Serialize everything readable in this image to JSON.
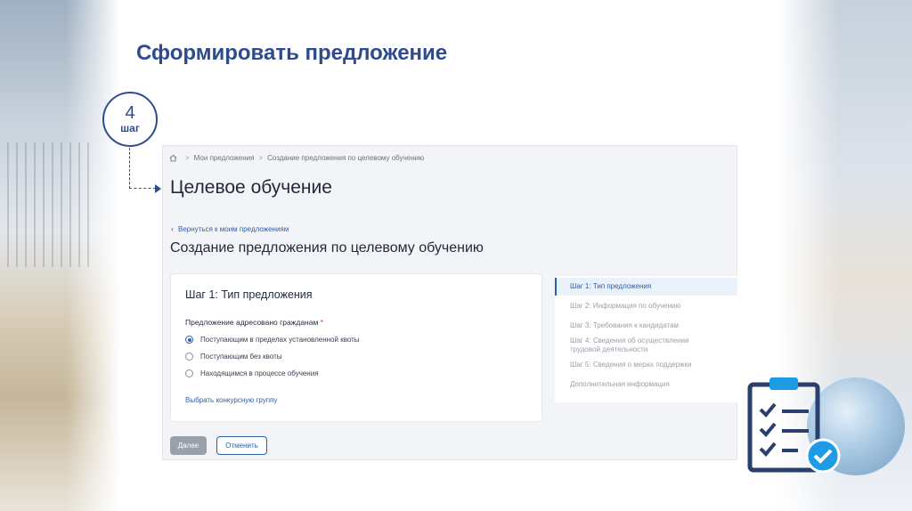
{
  "slide": {
    "title": "Сформировать предложение",
    "step_number": "4",
    "step_word": "шаг"
  },
  "breadcrumb": {
    "items": [
      "Мои предложения",
      "Создание предложения по целевому обучению"
    ],
    "separator": ">"
  },
  "page": {
    "heading": "Целевое обучение",
    "back_link": "Вернуться к моим предложениям",
    "sub_heading": "Создание предложения по целевому обучению"
  },
  "form": {
    "card_title": "Шаг 1: Тип предложения",
    "field_label": "Предложение адресовано гражданам",
    "required_mark": "*",
    "options": [
      {
        "label": "Поступающим в пределах установленной квоты",
        "checked": true
      },
      {
        "label": "Поступающим без квоты",
        "checked": false
      },
      {
        "label": "Находящимся в процессе обучения",
        "checked": false
      }
    ],
    "group_link": "Выбрать конкурсную группу"
  },
  "steps_nav": {
    "items": [
      "Шаг 1: Тип предложения",
      "Шаг 2: Информация по обучению",
      "Шаг 3: Требования к кандидатам",
      "Шаг 4: Сведения об осуществлении трудовой деятельности",
      "Шаг 5: Сведения о мерах поддержки",
      "Дополнительная информация"
    ],
    "active_index": 0
  },
  "buttons": {
    "next_label": "Далее",
    "cancel_label": "Отменить"
  },
  "colors": {
    "title_blue": "#2f4b8f",
    "link_blue": "#2f5fa8",
    "icon_blue": "#1e9be6"
  },
  "icons": {
    "home": "home-icon",
    "back": "chevron-left-icon",
    "checklist": "clipboard-checklist-icon"
  }
}
